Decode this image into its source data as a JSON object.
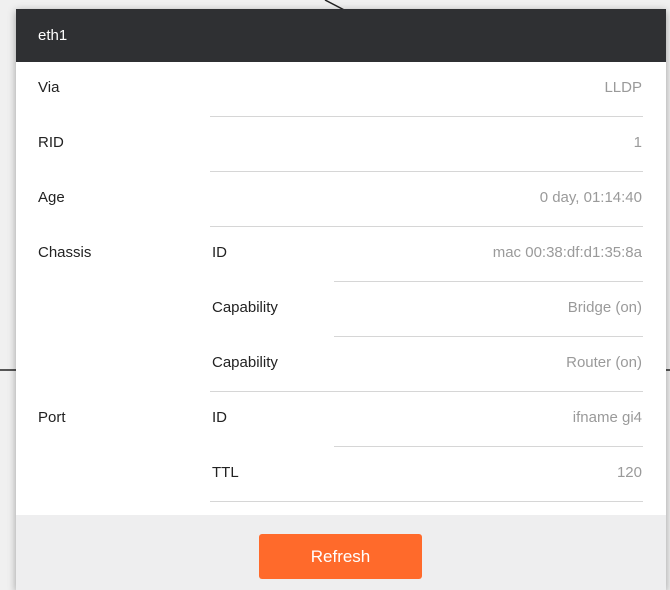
{
  "panel": {
    "title": "eth1",
    "rows": [
      {
        "label": "Via",
        "sublabel": "",
        "value": "LLDP"
      },
      {
        "label": "RID",
        "sublabel": "",
        "value": "1"
      },
      {
        "label": "Age",
        "sublabel": "",
        "value": "0 day, 01:14:40"
      },
      {
        "label": "Chassis",
        "sublabel": "ID",
        "value": "mac 00:38:df:d1:35:8a"
      },
      {
        "label": "",
        "sublabel": "Capability",
        "value": "Bridge (on)"
      },
      {
        "label": "",
        "sublabel": "Capability",
        "value": "Router (on)"
      },
      {
        "label": "Port",
        "sublabel": "ID",
        "value": "ifname gi4"
      },
      {
        "label": "",
        "sublabel": "TTL",
        "value": "120"
      }
    ],
    "refresh_label": "Refresh"
  },
  "colors": {
    "header_bg": "#2f3033",
    "accent": "#ff6a2b",
    "value_text": "#9a9a9a"
  }
}
